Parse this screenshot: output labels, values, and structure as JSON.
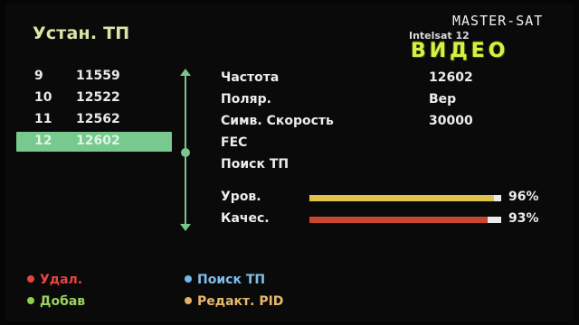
{
  "screen_title": "Устан. ТП",
  "watermark": "MASTER-SAT",
  "satellite": "Intelsat 12",
  "mode_badge": "ВИДЕО",
  "transponders": [
    {
      "num": "9",
      "freq": "11559",
      "selected": false
    },
    {
      "num": "10",
      "freq": "12522",
      "selected": false
    },
    {
      "num": "11",
      "freq": "12562",
      "selected": false
    },
    {
      "num": "12",
      "freq": "12602",
      "selected": true
    }
  ],
  "params": [
    {
      "label": "Частота",
      "value": "12602"
    },
    {
      "label": "Поляр.",
      "value": "Вер"
    },
    {
      "label": "Симв. Скорость",
      "value": "30000"
    },
    {
      "label": "FEC",
      "value": ""
    },
    {
      "label": "Поиск ТП",
      "value": ""
    }
  ],
  "signal": {
    "level": {
      "label": "Уров.",
      "percent_text": "96%",
      "fill": 0.96,
      "color": "#e0c24a"
    },
    "quality": {
      "label": "Качес.",
      "percent_text": "93%",
      "fill": 0.93,
      "color": "#c9462f"
    }
  },
  "legend": [
    {
      "label": "Удал.",
      "color": "#e2453b",
      "text_color": "#e7453d"
    },
    {
      "label": "Добав",
      "color": "#8ccf4a",
      "text_color": "#9bd35c"
    },
    {
      "label": "Поиск ТП",
      "color": "#6fb8e8",
      "text_color": "#7fbfeb"
    },
    {
      "label": "Редакт. PID",
      "color": "#e3b064",
      "text_color": "#e8b86a"
    }
  ]
}
